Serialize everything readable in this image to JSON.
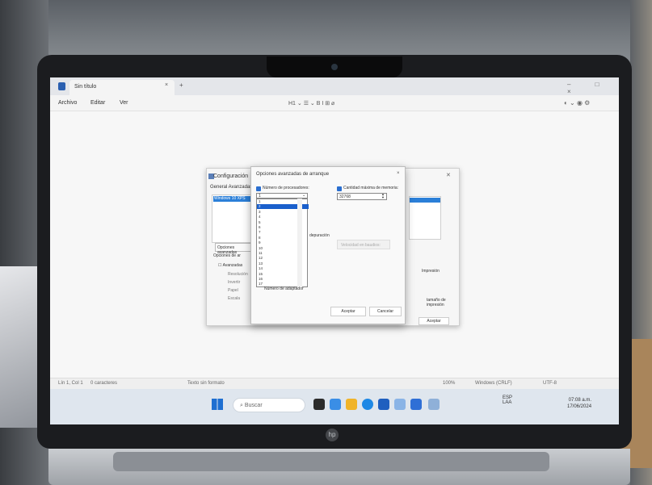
{
  "window": {
    "tab_title": "Sin título",
    "tab_close": "×",
    "tab_add": "+",
    "controls": "– □ ×"
  },
  "menu": {
    "archivo": "Archivo",
    "editar": "Editar",
    "ver": "Ver",
    "format_toolbar": "H1 ⌄   ☰ ⌄   B  I  ⊞  ⌀",
    "settings": "◐ ⌄   ◉   ⚙"
  },
  "status": {
    "position": "Lín 1, Col 1",
    "chars": "0 caracteres",
    "format": "Texto sin formato",
    "zoom": "100%",
    "eol": "Windows (CRLF)",
    "encoding": "UTF-8"
  },
  "taskbar": {
    "search": "Buscar",
    "lang_top": "ESP",
    "lang_bottom": "LAA",
    "time": "07:08 a.m.",
    "date": "17/06/2024"
  },
  "config_dialog": {
    "title": "Configuración",
    "tabs": "General  Avanzadas",
    "printer": "Windows 10 XPS",
    "options_button": "Opciones avanzadas",
    "section_label": "Opciones de ar",
    "check_label": "Avanzadas",
    "sub1": "Resolución",
    "sub2": "Invertir",
    "sub3": "Papel",
    "sub4": "Escala",
    "right_label": "Impresión",
    "right_label2": "tamaño de impresión",
    "print_button": "Aceptar"
  },
  "advanced_dialog": {
    "title": "Opciones avanzadas de arranque",
    "close": "×",
    "processors_label": "Número de procesadores:",
    "processors_value": "1",
    "memory_label": "Cantidad máxima de memoria:",
    "memory_value": "32768",
    "dropdown_items": [
      "1",
      "2",
      "3",
      "4",
      "5",
      "6",
      "7",
      "8",
      "9",
      "10",
      "11",
      "12",
      "13",
      "14",
      "15",
      "16",
      "17"
    ],
    "selected_index": 1,
    "side_label": "depuración",
    "disabled_field": "Velocidad en baudios:",
    "bottom_label": "Número de adaptador",
    "accept": "Aceptar",
    "cancel": "Cancelar"
  }
}
